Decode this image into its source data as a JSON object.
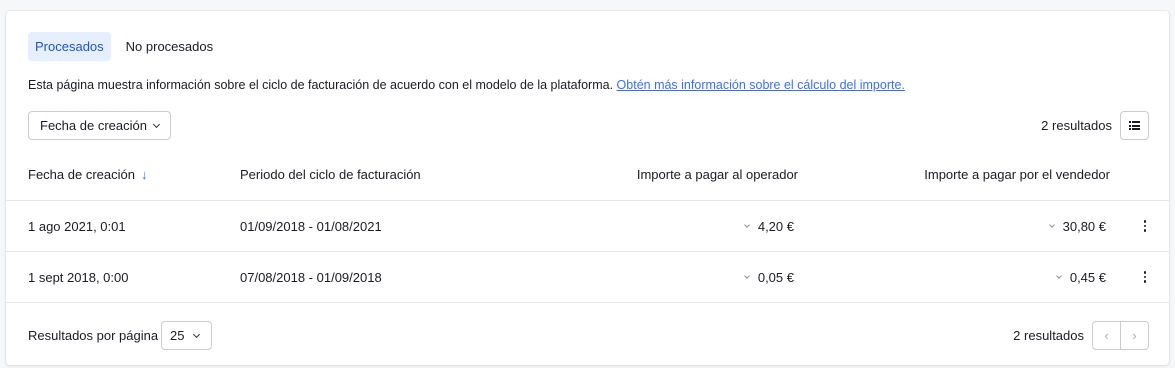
{
  "tabs": [
    {
      "label": "Procesados",
      "active": true
    },
    {
      "label": "No procesados",
      "active": false
    }
  ],
  "description": {
    "text": "Esta página muestra información sobre el ciclo de facturación de acuerdo con el modelo de la plataforma.",
    "link": "Obtén más información sobre el cálculo del importe."
  },
  "filter": {
    "label": "Fecha de creación"
  },
  "results_count": "2 resultados",
  "table": {
    "headers": [
      "Fecha de creación",
      "Periodo del ciclo de facturación",
      "Importe a pagar al operador",
      "Importe a pagar por el vendedor"
    ],
    "sort_icon": "arrow-down-icon",
    "rows": [
      {
        "fecha": "1 ago 2021, 0:01",
        "periodo": "01/09/2018 - 01/08/2021",
        "operador": "4,20 €",
        "vendedor": "30,80 €"
      },
      {
        "fecha": "1 sept 2018, 0:00",
        "periodo": "07/08/2018 - 01/09/2018",
        "operador": "0,05 €",
        "vendedor": "0,45 €"
      }
    ]
  },
  "footer": {
    "per_page_label": "Resultados por página",
    "per_page_value": "25",
    "results_count": "2 resultados",
    "prev_icon": "‹",
    "next_icon": "›"
  },
  "colors": {
    "accent": "#3c6ff0",
    "tab_active_bg": "#e6efff",
    "tab_active_text": "#1f56c6"
  }
}
